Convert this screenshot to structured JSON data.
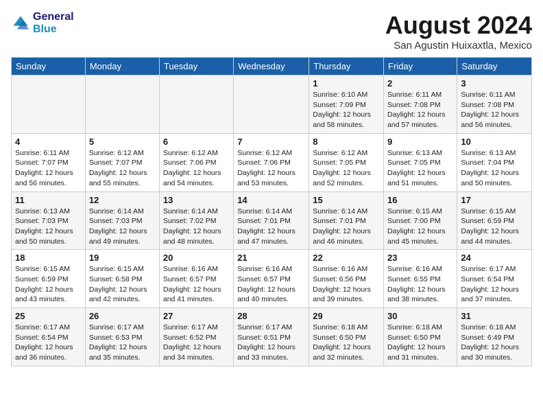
{
  "header": {
    "logo_line1": "General",
    "logo_line2": "Blue",
    "month_year": "August 2024",
    "location": "San Agustin Huixaxtla, Mexico"
  },
  "days_of_week": [
    "Sunday",
    "Monday",
    "Tuesday",
    "Wednesday",
    "Thursday",
    "Friday",
    "Saturday"
  ],
  "weeks": [
    [
      {
        "day": "",
        "content": ""
      },
      {
        "day": "",
        "content": ""
      },
      {
        "day": "",
        "content": ""
      },
      {
        "day": "",
        "content": ""
      },
      {
        "day": "1",
        "content": "Sunrise: 6:10 AM\nSunset: 7:09 PM\nDaylight: 12 hours\nand 58 minutes."
      },
      {
        "day": "2",
        "content": "Sunrise: 6:11 AM\nSunset: 7:08 PM\nDaylight: 12 hours\nand 57 minutes."
      },
      {
        "day": "3",
        "content": "Sunrise: 6:11 AM\nSunset: 7:08 PM\nDaylight: 12 hours\nand 56 minutes."
      }
    ],
    [
      {
        "day": "4",
        "content": "Sunrise: 6:11 AM\nSunset: 7:07 PM\nDaylight: 12 hours\nand 56 minutes."
      },
      {
        "day": "5",
        "content": "Sunrise: 6:12 AM\nSunset: 7:07 PM\nDaylight: 12 hours\nand 55 minutes."
      },
      {
        "day": "6",
        "content": "Sunrise: 6:12 AM\nSunset: 7:06 PM\nDaylight: 12 hours\nand 54 minutes."
      },
      {
        "day": "7",
        "content": "Sunrise: 6:12 AM\nSunset: 7:06 PM\nDaylight: 12 hours\nand 53 minutes."
      },
      {
        "day": "8",
        "content": "Sunrise: 6:12 AM\nSunset: 7:05 PM\nDaylight: 12 hours\nand 52 minutes."
      },
      {
        "day": "9",
        "content": "Sunrise: 6:13 AM\nSunset: 7:05 PM\nDaylight: 12 hours\nand 51 minutes."
      },
      {
        "day": "10",
        "content": "Sunrise: 6:13 AM\nSunset: 7:04 PM\nDaylight: 12 hours\nand 50 minutes."
      }
    ],
    [
      {
        "day": "11",
        "content": "Sunrise: 6:13 AM\nSunset: 7:03 PM\nDaylight: 12 hours\nand 50 minutes."
      },
      {
        "day": "12",
        "content": "Sunrise: 6:14 AM\nSunset: 7:03 PM\nDaylight: 12 hours\nand 49 minutes."
      },
      {
        "day": "13",
        "content": "Sunrise: 6:14 AM\nSunset: 7:02 PM\nDaylight: 12 hours\nand 48 minutes."
      },
      {
        "day": "14",
        "content": "Sunrise: 6:14 AM\nSunset: 7:01 PM\nDaylight: 12 hours\nand 47 minutes."
      },
      {
        "day": "15",
        "content": "Sunrise: 6:14 AM\nSunset: 7:01 PM\nDaylight: 12 hours\nand 46 minutes."
      },
      {
        "day": "16",
        "content": "Sunrise: 6:15 AM\nSunset: 7:00 PM\nDaylight: 12 hours\nand 45 minutes."
      },
      {
        "day": "17",
        "content": "Sunrise: 6:15 AM\nSunset: 6:59 PM\nDaylight: 12 hours\nand 44 minutes."
      }
    ],
    [
      {
        "day": "18",
        "content": "Sunrise: 6:15 AM\nSunset: 6:59 PM\nDaylight: 12 hours\nand 43 minutes."
      },
      {
        "day": "19",
        "content": "Sunrise: 6:15 AM\nSunset: 6:58 PM\nDaylight: 12 hours\nand 42 minutes."
      },
      {
        "day": "20",
        "content": "Sunrise: 6:16 AM\nSunset: 6:57 PM\nDaylight: 12 hours\nand 41 minutes."
      },
      {
        "day": "21",
        "content": "Sunrise: 6:16 AM\nSunset: 6:57 PM\nDaylight: 12 hours\nand 40 minutes."
      },
      {
        "day": "22",
        "content": "Sunrise: 6:16 AM\nSunset: 6:56 PM\nDaylight: 12 hours\nand 39 minutes."
      },
      {
        "day": "23",
        "content": "Sunrise: 6:16 AM\nSunset: 6:55 PM\nDaylight: 12 hours\nand 38 minutes."
      },
      {
        "day": "24",
        "content": "Sunrise: 6:17 AM\nSunset: 6:54 PM\nDaylight: 12 hours\nand 37 minutes."
      }
    ],
    [
      {
        "day": "25",
        "content": "Sunrise: 6:17 AM\nSunset: 6:54 PM\nDaylight: 12 hours\nand 36 minutes."
      },
      {
        "day": "26",
        "content": "Sunrise: 6:17 AM\nSunset: 6:53 PM\nDaylight: 12 hours\nand 35 minutes."
      },
      {
        "day": "27",
        "content": "Sunrise: 6:17 AM\nSunset: 6:52 PM\nDaylight: 12 hours\nand 34 minutes."
      },
      {
        "day": "28",
        "content": "Sunrise: 6:17 AM\nSunset: 6:51 PM\nDaylight: 12 hours\nand 33 minutes."
      },
      {
        "day": "29",
        "content": "Sunrise: 6:18 AM\nSunset: 6:50 PM\nDaylight: 12 hours\nand 32 minutes."
      },
      {
        "day": "30",
        "content": "Sunrise: 6:18 AM\nSunset: 6:50 PM\nDaylight: 12 hours\nand 31 minutes."
      },
      {
        "day": "31",
        "content": "Sunrise: 6:18 AM\nSunset: 6:49 PM\nDaylight: 12 hours\nand 30 minutes."
      }
    ]
  ]
}
